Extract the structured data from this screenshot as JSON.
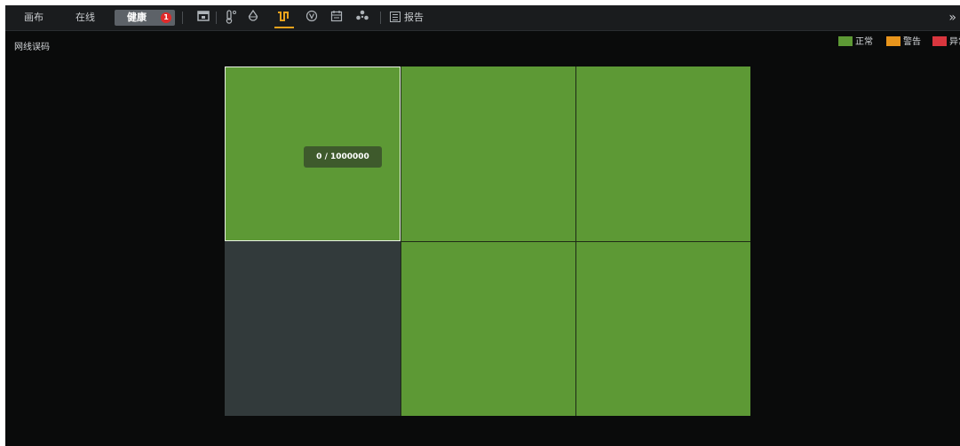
{
  "toolbar": {
    "tabs": {
      "canvas": "画布",
      "online": "在线",
      "health": "健康",
      "health_badge": "1"
    },
    "icons": [
      "screen-icon",
      "thermometer-icon",
      "droplet-icon",
      "curve-icon",
      "voltage-icon",
      "calendar-icon",
      "fan-icon"
    ],
    "active_icon": "curve-icon",
    "report_label": "报告",
    "more_label": "»"
  },
  "panel": {
    "title": "网线误码"
  },
  "legend": {
    "items": [
      {
        "label": "正常",
        "color": "#5d9935"
      },
      {
        "label": "警告",
        "color": "#e8951c"
      },
      {
        "label": "异常",
        "color": "#d9363e"
      }
    ]
  },
  "grid": {
    "rows": 2,
    "cols": 3,
    "cells": [
      {
        "status": "normal",
        "selected": true
      },
      {
        "status": "normal"
      },
      {
        "status": "normal"
      },
      {
        "status": "none"
      },
      {
        "status": "normal"
      },
      {
        "status": "normal"
      }
    ],
    "tooltip": "0 / 1000000"
  },
  "colors": {
    "normal": "#5d9935",
    "none": "#323a3b",
    "accent": "#e8a21c",
    "background": "#0a0b0b"
  }
}
